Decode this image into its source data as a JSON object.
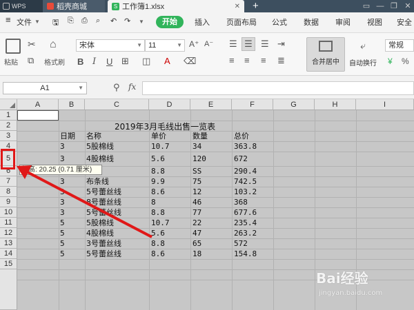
{
  "titlebar": {
    "tabs": [
      {
        "label": "WPS"
      },
      {
        "label": "稻壳商城"
      },
      {
        "label": "工作簿1.xlsx"
      }
    ],
    "new_tab": "+"
  },
  "menu": {
    "file": "文件",
    "start": "开始",
    "items": [
      "插入",
      "页面布局",
      "公式",
      "数据",
      "审阅",
      "视图",
      "安全"
    ]
  },
  "ribbon": {
    "paste": "粘贴",
    "format_painter": "格式刷",
    "font": "宋体",
    "font_size": "11",
    "merge_center": "合并居中",
    "wrap_text": "自动换行",
    "number_format": "常规"
  },
  "formula_bar": {
    "name_box": "A1",
    "fx": "fx"
  },
  "sheet": {
    "columns": [
      "A",
      "B",
      "C",
      "D",
      "E",
      "F",
      "G",
      "H",
      "I"
    ],
    "rows": [
      "1",
      "2",
      "3",
      "4",
      "5",
      "6",
      "7",
      "8",
      "9",
      "10",
      "11",
      "12",
      "13",
      "14",
      "15"
    ],
    "title": "2019年3月毛线出售一览表",
    "headers": {
      "date": "日期",
      "name": "名称",
      "price": "单价",
      "qty": "数量",
      "total": "总价"
    },
    "data_rows": [
      {
        "date": "3",
        "name": "5股棉线",
        "price": "10.7",
        "qty": "34",
        "total": "363.8"
      },
      {
        "date": "3",
        "name": "4股棉线",
        "price": "5.6",
        "qty": "120",
        "total": "672"
      },
      {
        "date": "",
        "name": "棉线",
        "price": "8.8",
        "qty": "SS",
        "total": "290.4"
      },
      {
        "date": "3",
        "name": "布条线",
        "price": "9.9",
        "qty": "75",
        "total": "742.5"
      },
      {
        "date": "3",
        "name": "5号蕾丝线",
        "price": "8.6",
        "qty": "12",
        "total": "103.2"
      },
      {
        "date": "3",
        "name": "8号蕾丝线",
        "price": "8",
        "qty": "46",
        "total": "368"
      },
      {
        "date": "3",
        "name": "5号蕾丝线",
        "price": "8.8",
        "qty": "77",
        "total": "677.6"
      },
      {
        "date": "5",
        "name": "5股棉线",
        "price": "10.7",
        "qty": "22",
        "total": "235.4"
      },
      {
        "date": "5",
        "name": "4股棉线",
        "price": "5.6",
        "qty": "47",
        "total": "263.2"
      },
      {
        "date": "5",
        "name": "3号蕾丝线",
        "price": "8.8",
        "qty": "65",
        "total": "572"
      },
      {
        "date": "5",
        "name": "5号蕾丝线",
        "price": "8.6",
        "qty": "18",
        "total": "154.8"
      }
    ],
    "tooltip": "行高: 20.25 (0.71 厘米)"
  },
  "watermark": {
    "brand": "Bai经验",
    "url": "jingyan.baidu.com"
  },
  "colors": {
    "accent_green": "#31b45b",
    "highlight_red": "#e01818",
    "sheet_gray": "#c7c7c7"
  }
}
